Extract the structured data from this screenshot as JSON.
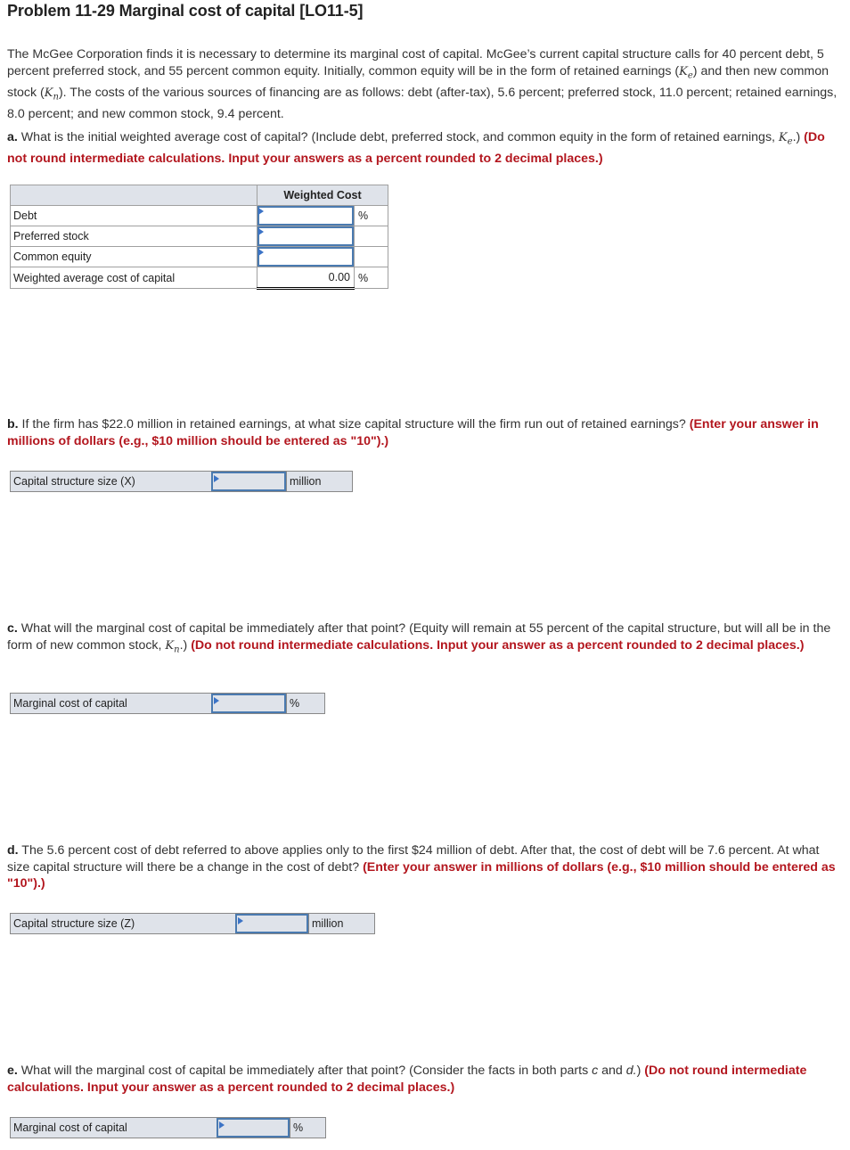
{
  "title": "Problem 11-29 Marginal cost of capital [LO11-5]",
  "intro": {
    "part1": "The McGee Corporation finds it is necessary to determine its marginal cost of capital. McGee’s current capital structure calls for 40 percent debt, 5 percent preferred stock, and 55 percent common equity. Initially, common equity will be in the form of retained earnings (",
    "ke_symbol": "K",
    "ke_sub": "e",
    "part2": ") and then new common stock (",
    "kn_symbol": "K",
    "kn_sub": "n",
    "part3": "). The costs of the various sources of financing are as follows: debt (after-tax), 5.6 percent; preferred stock, 11.0 percent; retained earnings, 8.0 percent; and new common stock, 9.4 percent."
  },
  "part_a": {
    "letter": "a.",
    "text1": " What is the initial weighted average cost of capital? (Include debt, preferred stock, and common equity in the form of retained earnings, ",
    "sym": "K",
    "sub": "e",
    "text2": ".) ",
    "instruction": "(Do not round intermediate calculations. Input your answers as a percent rounded to 2 decimal places.)",
    "table": {
      "header": "Weighted Cost",
      "rows": [
        {
          "label": "Debt",
          "value": "",
          "unit": "%"
        },
        {
          "label": "Preferred stock",
          "value": "",
          "unit": ""
        },
        {
          "label": "Common equity",
          "value": "",
          "unit": ""
        }
      ],
      "total": {
        "label": "Weighted average cost of capital",
        "value": "0.00",
        "unit": "%"
      }
    }
  },
  "part_b": {
    "letter": "b.",
    "text": " If the firm has $22.0 million in retained earnings, at what size capital structure will the firm run out of retained earnings? ",
    "instruction": "(Enter your answer in millions of dollars (e.g., $10 million should be entered as \"10\").)",
    "label": "Capital structure size (X)",
    "value": "",
    "unit": "million"
  },
  "part_c": {
    "letter": "c.",
    "text1": " What will the marginal cost of capital be immediately after that point? (Equity will remain at 55 percent of the capital structure, but will all be in the form of new common stock, ",
    "sym": "K",
    "sub": "n",
    "text2": ".) ",
    "instruction": "(Do not round intermediate calculations. Input your answer as a percent rounded to 2 decimal places.)",
    "label": "Marginal cost of capital",
    "value": "",
    "unit": "%"
  },
  "part_d": {
    "letter": "d.",
    "text": " The 5.6 percent cost of debt referred to above applies only to the first $24 million of debt. After that, the cost of debt will be 7.6 percent. At what size capital structure will there be a change in the cost of debt? ",
    "instruction": "(Enter your answer in millions of dollars (e.g., $10 million should be entered as \"10\").)",
    "label": "Capital structure size (Z)",
    "value": "",
    "unit": "million"
  },
  "part_e": {
    "letter": "e.",
    "text1": " What will the marginal cost of capital be immediately after that point? (Consider the facts in both parts ",
    "c": "c",
    "and": " and ",
    "d": "d.",
    "text2": ") ",
    "instruction": "(Do not round intermediate calculations. Input your answer as a percent rounded to 2 decimal places.)",
    "label": "Marginal cost of capital",
    "value": "",
    "unit": "%"
  },
  "colors": {
    "instruction_red": "#b3161e",
    "input_border": "#4a7ab0",
    "header_bg": "#dfe3ea"
  }
}
